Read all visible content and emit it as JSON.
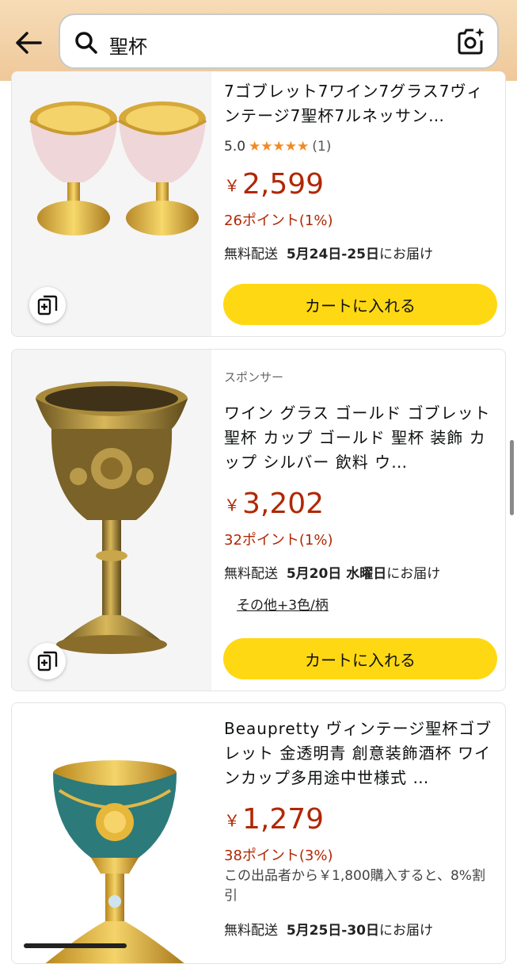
{
  "search": {
    "query": "聖杯"
  },
  "products": [
    {
      "title": "7ゴブレット7ワイン7グラス7ヴィンテージ7聖杯7ルネッサン…",
      "rating_value": "5.0",
      "rating_stars": "★★★★★",
      "rating_count": "(1)",
      "price_symbol": "￥",
      "price": "2,599",
      "points": "26ポイント(1%)",
      "delivery_prefix": "無料配送",
      "delivery_date": "5月24日-25日",
      "delivery_suffix": "にお届け",
      "cart_label": "カートに入れる"
    },
    {
      "sponsored": "スポンサー",
      "title": "ワイン グラス ゴールド ゴブレット 聖杯 カップ ゴールド 聖杯 装飾 カップ シルバー 飲料 ウ…",
      "price_symbol": "￥",
      "price": "3,202",
      "points": "32ポイント(1%)",
      "delivery_prefix": "無料配送",
      "delivery_date": "5月20日 水曜日",
      "delivery_suffix": "にお届け",
      "more_colors": "その他+3色/柄",
      "cart_label": "カートに入れる"
    },
    {
      "title": "Beaupretty ヴィンテージ聖杯ゴブレット 金透明青 創意装飾酒杯 ワインカップ多用途中世様式 …",
      "price_symbol": "￥",
      "price": "1,279",
      "points": "38ポイント(3%)",
      "coupon": "この出品者から￥1,800購入すると、8%割引",
      "delivery_prefix": "無料配送",
      "delivery_date": "5月25日-30日",
      "delivery_suffix": "にお届け"
    }
  ],
  "colors": {
    "accent_price": "#b12704",
    "cart_button": "#ffd814",
    "star": "#f08a24",
    "header": "#f2d0a6"
  }
}
